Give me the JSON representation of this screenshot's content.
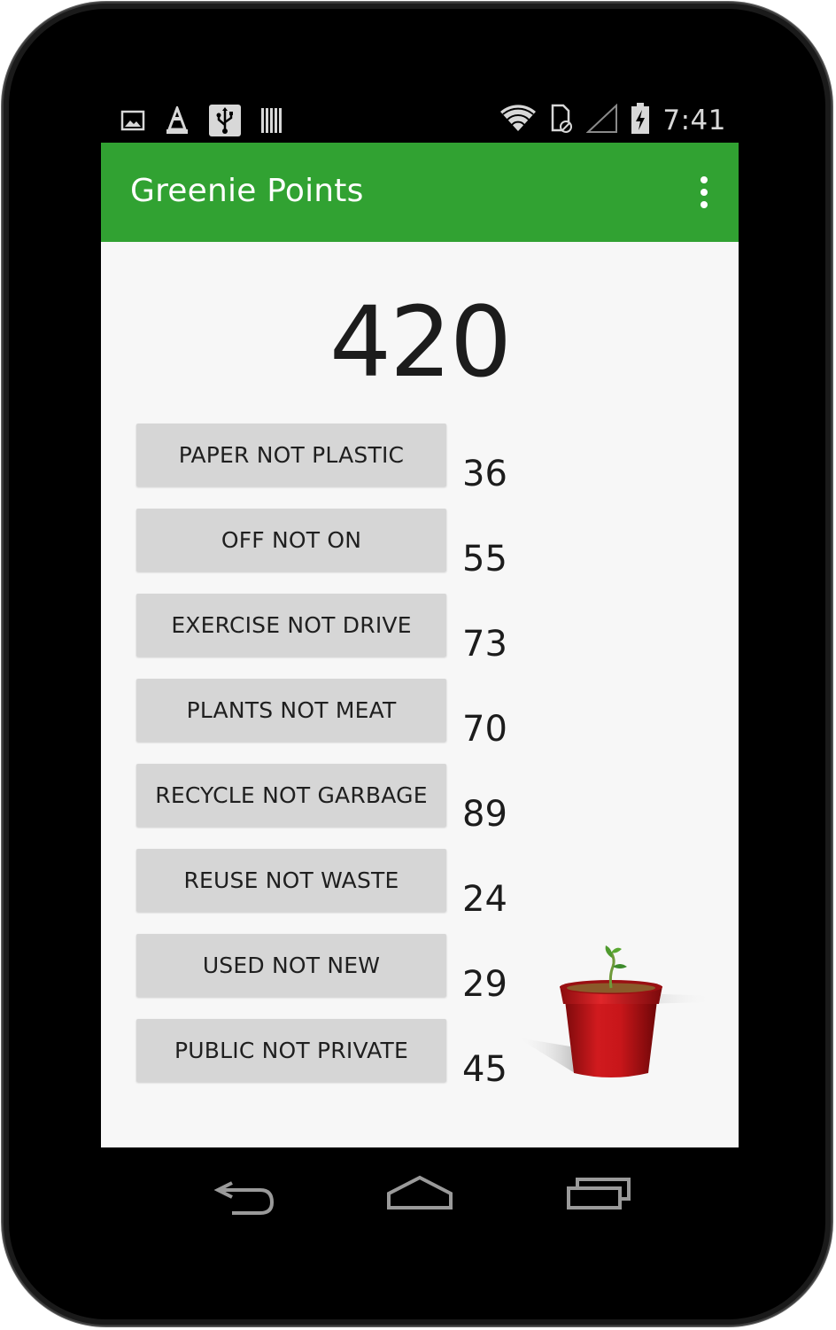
{
  "status_bar": {
    "time": "7:41",
    "left_icons": [
      "image-icon",
      "vlc-cone-icon",
      "usb-icon",
      "barcode-icon"
    ],
    "right_icons": [
      "wifi-icon",
      "sim-card-icon",
      "signal-icon",
      "battery-charging-icon"
    ]
  },
  "app_bar": {
    "title": "Greenie Points",
    "menu_icon": "overflow-menu-icon"
  },
  "total_points": "420",
  "actions": [
    {
      "label": "PAPER NOT PLASTIC",
      "score": "36"
    },
    {
      "label": "OFF NOT ON",
      "score": "55"
    },
    {
      "label": "EXERCISE NOT DRIVE",
      "score": "73"
    },
    {
      "label": "PLANTS NOT MEAT",
      "score": "70"
    },
    {
      "label": "RECYCLE NOT GARBAGE",
      "score": "89"
    },
    {
      "label": "REUSE NOT WASTE",
      "score": "24"
    },
    {
      "label": "USED NOT NEW",
      "score": "29"
    },
    {
      "label": "PUBLIC NOT PRIVATE",
      "score": "45"
    }
  ],
  "nav_bar": {
    "icons": [
      "back-icon",
      "home-icon",
      "recents-icon"
    ]
  },
  "colors": {
    "app_bar": "#31a232",
    "screen_background": "#f7f7f7",
    "button_background": "#d6d6d6",
    "pot_red": "#c8161a"
  }
}
